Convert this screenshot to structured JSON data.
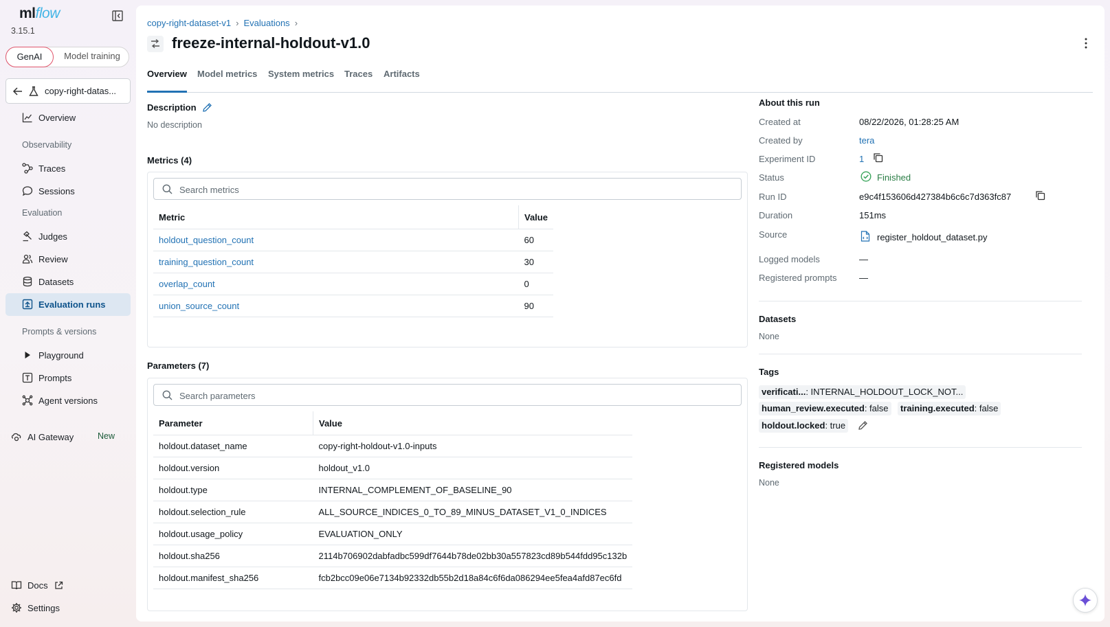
{
  "app": {
    "logo_ml": "ml",
    "logo_flow": "flow",
    "version": "3.15.1"
  },
  "mode_toggle": {
    "genai": "GenAI",
    "training": "Model training"
  },
  "experiment_selector": {
    "label": "copy-right-datas..."
  },
  "nav": {
    "overview": "Overview",
    "observability": "Observability",
    "traces": "Traces",
    "sessions": "Sessions",
    "evaluation": "Evaluation",
    "judges": "Judges",
    "review": "Review",
    "datasets": "Datasets",
    "evaluation_runs": "Evaluation runs",
    "prompts_versions": "Prompts & versions",
    "playground": "Playground",
    "prompts": "Prompts",
    "agent_versions": "Agent versions",
    "ai_gateway": "AI Gateway",
    "ai_gateway_badge": "New",
    "docs": "Docs",
    "settings": "Settings"
  },
  "breadcrumb": {
    "experiment": "copy-right-dataset-v1",
    "section": "Evaluations"
  },
  "run": {
    "title": "freeze-internal-holdout-v1.0"
  },
  "tabs": {
    "overview": "Overview",
    "model_metrics": "Model metrics",
    "system_metrics": "System metrics",
    "traces": "Traces",
    "artifacts": "Artifacts"
  },
  "description": {
    "heading": "Description",
    "text": "No description"
  },
  "metrics": {
    "heading": "Metrics (4)",
    "search_placeholder": "Search metrics",
    "col_metric": "Metric",
    "col_value": "Value",
    "rows": [
      {
        "name": "holdout_question_count",
        "value": "60"
      },
      {
        "name": "training_question_count",
        "value": "30"
      },
      {
        "name": "overlap_count",
        "value": "0"
      },
      {
        "name": "union_source_count",
        "value": "90"
      }
    ]
  },
  "parameters": {
    "heading": "Parameters (7)",
    "search_placeholder": "Search parameters",
    "col_param": "Parameter",
    "col_value": "Value",
    "rows": [
      {
        "name": "holdout.dataset_name",
        "value": "copy-right-holdout-v1.0-inputs"
      },
      {
        "name": "holdout.version",
        "value": "holdout_v1.0"
      },
      {
        "name": "holdout.type",
        "value": "INTERNAL_COMPLEMENT_OF_BASELINE_90"
      },
      {
        "name": "holdout.selection_rule",
        "value": "ALL_SOURCE_INDICES_0_TO_89_MINUS_DATASET_V1_0_INDICES"
      },
      {
        "name": "holdout.usage_policy",
        "value": "EVALUATION_ONLY"
      },
      {
        "name": "holdout.sha256",
        "value": "2114b706902dabfadbc599df7644b78de02bb30a557823cd89b544fdd95c132b"
      },
      {
        "name": "holdout.manifest_sha256",
        "value": "fcb2bcc09e06e7134b92332db55b2d18a84c6f6da086294ee5fea4afd87ec6fd"
      }
    ]
  },
  "about": {
    "heading": "About this run",
    "created_at_label": "Created at",
    "created_at": "08/22/2026, 01:28:25 AM",
    "created_by_label": "Created by",
    "created_by": "tera",
    "experiment_id_label": "Experiment ID",
    "experiment_id": "1",
    "status_label": "Status",
    "status": "Finished",
    "run_id_label": "Run ID",
    "run_id": "e9c4f153606d427384b6c6c7d363fc87",
    "duration_label": "Duration",
    "duration": "151ms",
    "source_label": "Source",
    "source": "register_holdout_dataset.py",
    "logged_models_label": "Logged models",
    "logged_models": "—",
    "registered_prompts_label": "Registered prompts",
    "registered_prompts": "—"
  },
  "datasets": {
    "heading": "Datasets",
    "value": "None"
  },
  "tags": {
    "heading": "Tags",
    "items": [
      {
        "key": "verificati...",
        "value": ": INTERNAL_HOLDOUT_LOCK_NOT..."
      },
      {
        "key": "human_review.executed",
        "value": ": false"
      },
      {
        "key": "training.executed",
        "value": ": false"
      },
      {
        "key": "holdout.locked",
        "value": ": true"
      }
    ]
  },
  "registered_models": {
    "heading": "Registered models",
    "value": "None"
  },
  "colors": {
    "accent": "#2272b4",
    "active_nav_bg": "#dde7f2",
    "success": "#3ba55c",
    "brand_flow": "#43b5e6"
  }
}
